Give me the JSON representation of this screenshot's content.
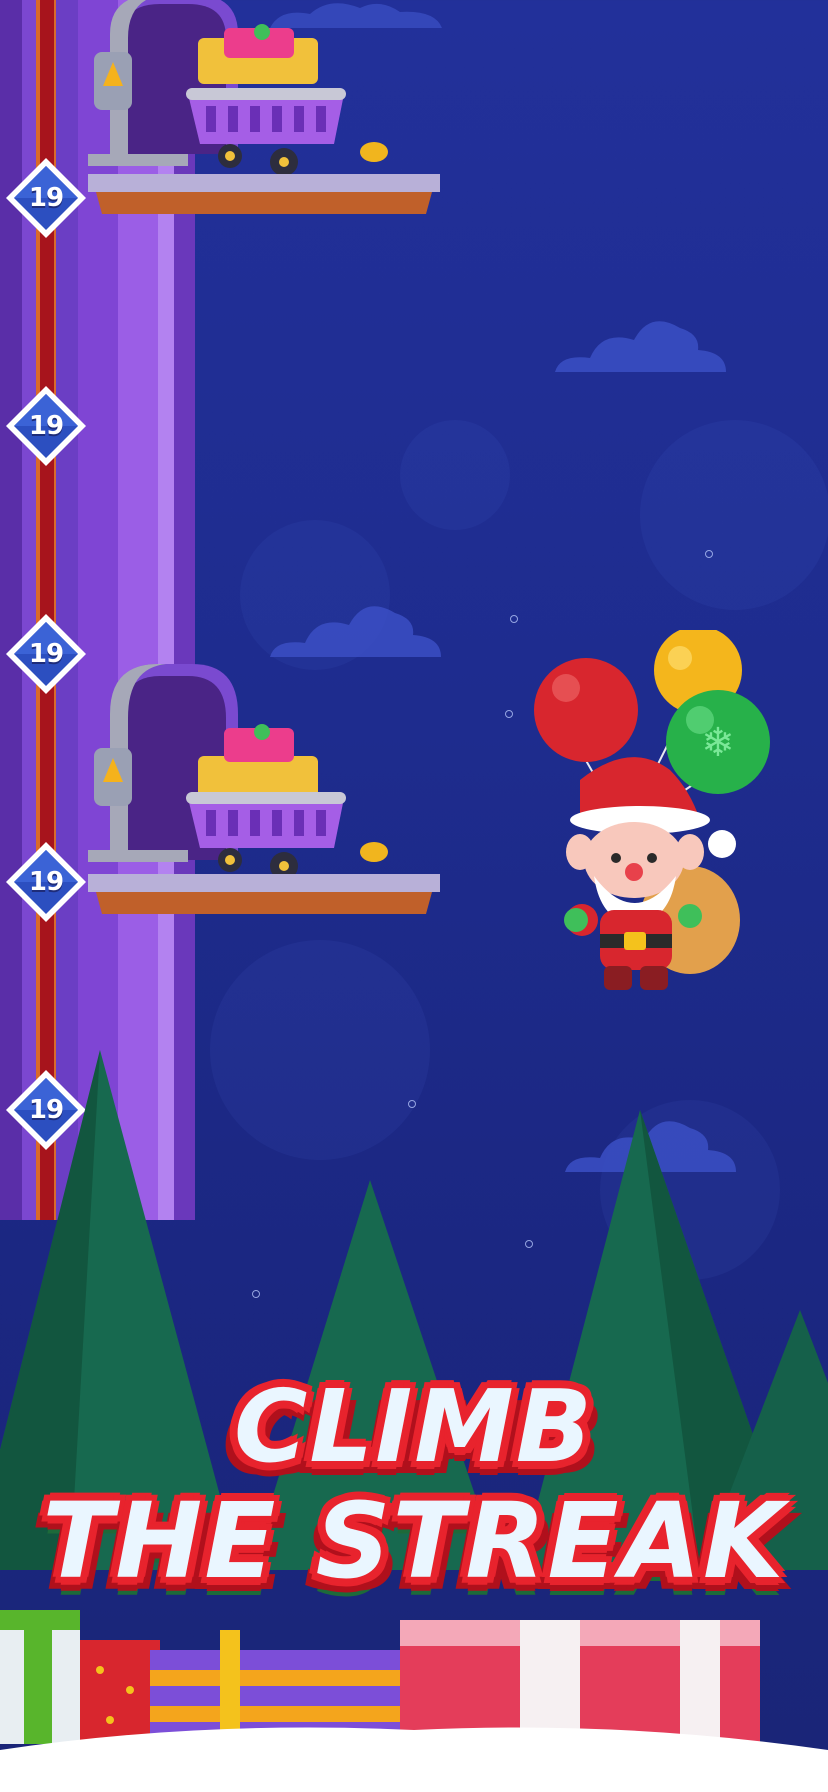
{
  "level_badges": [
    "19",
    "19",
    "19",
    "19",
    "19"
  ],
  "title": {
    "line1": "CLIMB",
    "line2": "THE STREAK"
  },
  "colors": {
    "sky": "#22309a",
    "tower_purple": "#8a4fd6",
    "rail_red": "#a7141c",
    "badge_blue": "#2c4fc0",
    "title_fill": "#eaf6ff",
    "title_outline": "#e8232d",
    "tree_green": "#14614d"
  },
  "icons": {
    "badge": "diamond-level-badge",
    "elevator": "elevator-door-icon",
    "cart": "gift-cart-icon",
    "character": "santa-balloon-character",
    "trees": "pine-tree-icon",
    "gifts": "gift-box-icon"
  }
}
